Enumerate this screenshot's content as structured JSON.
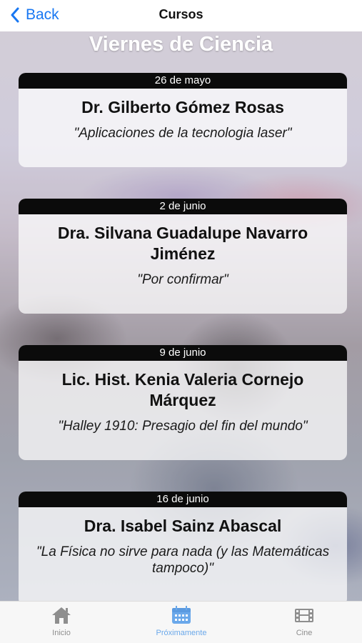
{
  "nav": {
    "back_label": "Back",
    "title": "Cursos"
  },
  "section_title": "Viernes de Ciencia",
  "events": [
    {
      "date": "26 de mayo",
      "speaker": "Dr. Gilberto Gómez Rosas",
      "topic": "\"Aplicaciones de la tecnologia laser\""
    },
    {
      "date": "2 de junio",
      "speaker": "Dra. Silvana Guadalupe Navarro Jiménez",
      "topic": "\"Por confirmar\""
    },
    {
      "date": "9 de junio",
      "speaker": "Lic. Hist. Kenia Valeria Cornejo Márquez",
      "topic": "\"Halley 1910: Presagio del fin del mundo\""
    },
    {
      "date": "16 de junio",
      "speaker": "Dra. Isabel Sainz Abascal",
      "topic": "\"La Física no sirve para nada (y las Matemáticas tampoco)\""
    }
  ],
  "tabs": [
    {
      "label": "Inicio",
      "icon": "home-icon",
      "active": false
    },
    {
      "label": "Próximamente",
      "icon": "calendar-icon",
      "active": true
    },
    {
      "label": "Cine",
      "icon": "film-icon",
      "active": false
    }
  ],
  "colors": {
    "accent": "#1877f2",
    "active_tab": "#6aa8ea",
    "inactive_tab": "#8e8e8e",
    "date_bar": "#0b0b0b"
  }
}
